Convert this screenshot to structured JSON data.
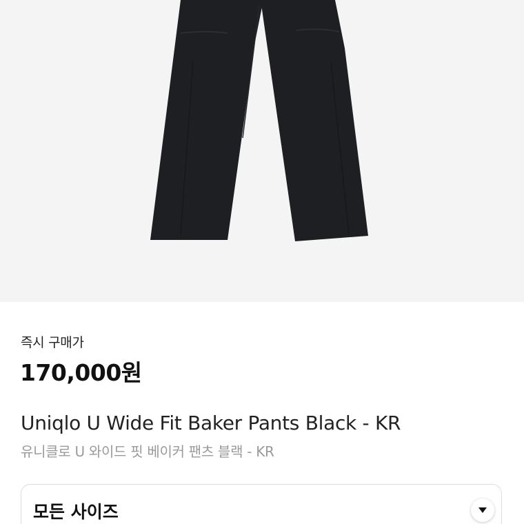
{
  "product": {
    "image_icon": "product-photo-pants",
    "instant_buy_label": "즉시 구매가",
    "price": "170,000원",
    "name_en": "Uniqlo U Wide Fit Baker Pants Black - KR",
    "name_ko": "유니클로 U 와이드 핏 베이커 팬츠 블랙 - KR"
  },
  "size_selector": {
    "selected": "모든 사이즈",
    "icon": "chevron-down-icon"
  },
  "colors": {
    "hero_bg": "#f4f4f4",
    "pants": "#1d1f22"
  }
}
